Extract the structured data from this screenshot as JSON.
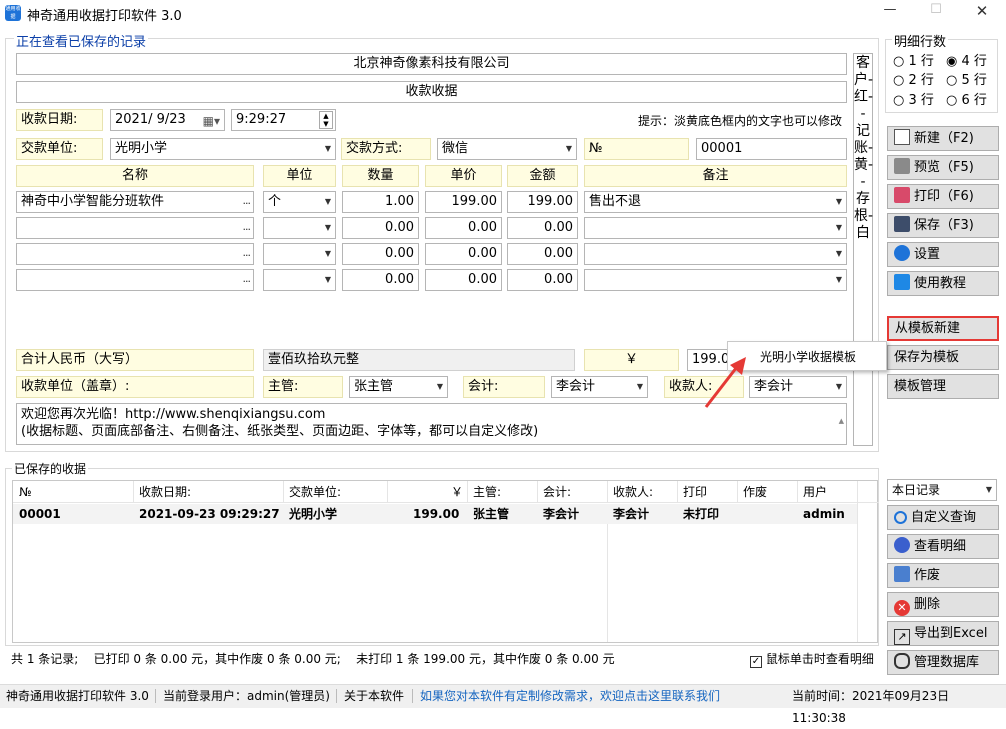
{
  "window": {
    "title": "神奇通用收据打印软件 3.0",
    "icon_text": "通用收据",
    "controls": [
      "—",
      "☐",
      "✕"
    ]
  },
  "record_label": "正在查看已保存的记录",
  "company": "北京神奇像素科技有限公司",
  "doc_title": "收款收据",
  "side_note": "客户-红--记账-黄--存根-白",
  "date": {
    "label": "收款日期:",
    "value": "2021/ 9/23",
    "time": "9:29:27"
  },
  "hint": "提示：淡黄底色框内的文字也可以修改",
  "payer": {
    "label": "交款单位:",
    "value": "光明小学"
  },
  "payment": {
    "label": "交款方式:",
    "value": "微信"
  },
  "number": {
    "label": "№",
    "value": "00001"
  },
  "items_header": {
    "name": "名称",
    "unit": "单位",
    "qty": "数量",
    "price": "单价",
    "amount": "金额",
    "remark": "备注"
  },
  "items": [
    {
      "name": "神奇中小学智能分班软件",
      "unit": "个",
      "qty": "1.00",
      "price": "199.00",
      "amount": "199.00",
      "remark": "售出不退"
    },
    {
      "name": "",
      "unit": "",
      "qty": "0.00",
      "price": "0.00",
      "amount": "0.00",
      "remark": ""
    },
    {
      "name": "",
      "unit": "",
      "qty": "0.00",
      "price": "0.00",
      "amount": "0.00",
      "remark": ""
    },
    {
      "name": "",
      "unit": "",
      "qty": "0.00",
      "price": "0.00",
      "amount": "0.00",
      "remark": ""
    }
  ],
  "total": {
    "label": "合计人民币（大写）",
    "value": "壹佰玖拾玖元整",
    "currency": "￥",
    "num": "199.00"
  },
  "signatures": {
    "unit_label": "收款单位（盖章）:",
    "supervisor_label": "主管:",
    "supervisor": "张主管",
    "accountant_label": "会计:",
    "accountant": "李会计",
    "payee_label": "收款人:",
    "payee": "李会计"
  },
  "footer_note": {
    "line1": "欢迎您再次光临！http://www.shenqixiangsu.com",
    "line2": "(收据标题、页面底部备注、右侧备注、纸张类型、页面边距、字体等，都可以自定义修改)"
  },
  "rows_option": {
    "title": "明细行数",
    "options": [
      "1 行",
      "4 行",
      "2 行",
      "5 行",
      "3 行",
      "6 行"
    ],
    "selected": "4 行"
  },
  "actions": {
    "new": "新建（F2)",
    "preview": "预览（F5)",
    "print": "打印（F6)",
    "save": "保存（F3)",
    "settings": "设置",
    "tutorial": "使用教程",
    "from_template": "从模板新建",
    "save_template": "保存为模板",
    "manage_template": "模板管理"
  },
  "template_popup": {
    "item": "光明小学收据模板"
  },
  "saved": {
    "title": "已保存的收据",
    "columns": [
      "№",
      "收款日期:",
      "交款单位:",
      "￥",
      "主管:",
      "会计:",
      "收款人:",
      "打印",
      "作废",
      "用户"
    ],
    "rows": [
      [
        "00001",
        "2021-09-23 09:29:27",
        "光明小学",
        "199.00",
        "张主管",
        "李会计",
        "李会计",
        "未打印",
        "",
        "admin"
      ]
    ],
    "filter": "本日记录",
    "summary": "共 1 条记录;    已打印 0 条 0.00 元，其中作废 0 条 0.00 元;    未打印 1 条 199.00 元，其中作废 0 条 0.00 元",
    "checkbox_label": "鼠标单击时查看明细",
    "checkbox_checked": true
  },
  "query_actions": {
    "custom": "自定义查询",
    "detail": "查看明细",
    "void": "作废",
    "delete": "删除",
    "export": "导出到Excel",
    "db": "管理数据库"
  },
  "status": {
    "app": "神奇通用收据打印软件 3.0",
    "user": "当前登录用户：admin(管理员)",
    "about": "关于本软件",
    "link": "如果您对本软件有定制修改需求，欢迎点击这里联系我们",
    "time": "当前时间：2021年09月23日 11:30:38"
  },
  "colors": {
    "accent_blue": "#1565c0",
    "highlight_red": "#e53935",
    "yellow_bg": "#fffde1"
  }
}
